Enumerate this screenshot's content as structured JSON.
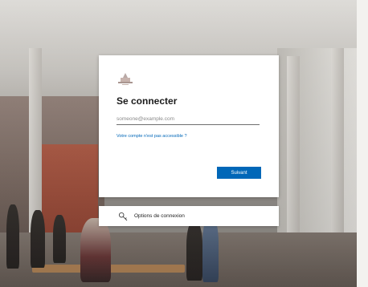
{
  "signin": {
    "title": "Se connecter",
    "email_placeholder": "someone@example.com",
    "email_value": "",
    "cant_access_link": "Votre compte n'est pas accessible ?",
    "next_button": "Suivant",
    "options_label": "Options de connexion"
  },
  "icons": {
    "logo": "organization-logo",
    "options": "key-icon"
  },
  "colors": {
    "accent": "#0067b8",
    "card_bg": "#ffffff",
    "text": "#1b1b1b"
  }
}
